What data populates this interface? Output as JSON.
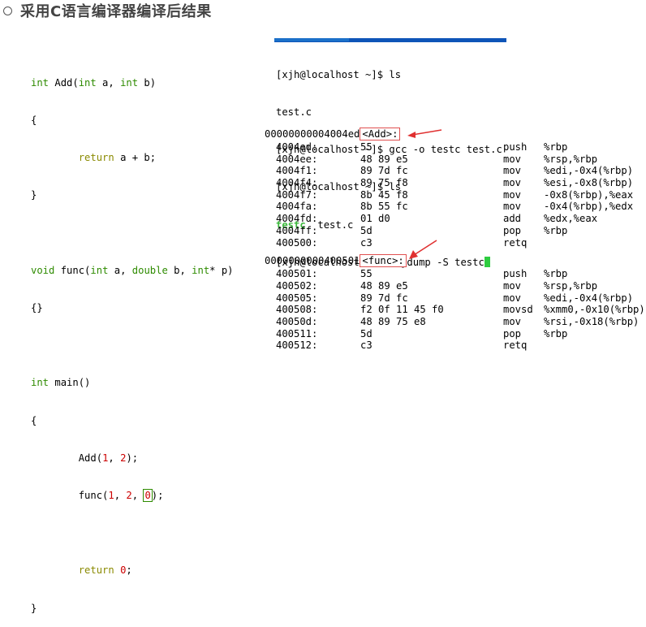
{
  "title": "采用C语言编译器编译后结果",
  "source_code": [
    "int Add(int a, int b)",
    "{",
    "        return a + b;",
    "}",
    "",
    "void func(int a, double b, int* p)",
    "{}",
    "",
    "int main()",
    "{",
    "        Add(1, 2);",
    "        func(1, 2, 0);",
    "",
    "        return 0;",
    "}"
  ],
  "terminal": {
    "lines": [
      "[xjh@localhost ~]$ ls",
      "test.c",
      "[xjh@localhost ~]$ gcc -o testc test.c",
      "[xjh@localhost ~]$ ls"
    ],
    "ls_result_exe": "testc",
    "ls_result_src": "  test.c",
    "last_prompt": "[xjh@localhost ~]$ objdump -S testc"
  },
  "disassembly": [
    {
      "address": "00000000004004ed",
      "symbol": "<Add>:",
      "rows": [
        {
          "addr": "4004ed:",
          "bytes": "55",
          "mnemonic": "push",
          "operands": "%rbp"
        },
        {
          "addr": "4004ee:",
          "bytes": "48 89 e5",
          "mnemonic": "mov",
          "operands": "%rsp,%rbp"
        },
        {
          "addr": "4004f1:",
          "bytes": "89 7d fc",
          "mnemonic": "mov",
          "operands": "%edi,-0x4(%rbp)"
        },
        {
          "addr": "4004f4:",
          "bytes": "89 75 f8",
          "mnemonic": "mov",
          "operands": "%esi,-0x8(%rbp)"
        },
        {
          "addr": "4004f7:",
          "bytes": "8b 45 f8",
          "mnemonic": "mov",
          "operands": "-0x8(%rbp),%eax"
        },
        {
          "addr": "4004fa:",
          "bytes": "8b 55 fc",
          "mnemonic": "mov",
          "operands": "-0x4(%rbp),%edx"
        },
        {
          "addr": "4004fd:",
          "bytes": "01 d0",
          "mnemonic": "add",
          "operands": "%edx,%eax"
        },
        {
          "addr": "4004ff:",
          "bytes": "5d",
          "mnemonic": "pop",
          "operands": "%rbp"
        },
        {
          "addr": "400500:",
          "bytes": "c3",
          "mnemonic": "retq",
          "operands": ""
        }
      ]
    },
    {
      "address": "0000000000400501",
      "symbol": "<func>:",
      "rows": [
        {
          "addr": "400501:",
          "bytes": "55",
          "mnemonic": "push",
          "operands": "%rbp"
        },
        {
          "addr": "400502:",
          "bytes": "48 89 e5",
          "mnemonic": "mov",
          "operands": "%rsp,%rbp"
        },
        {
          "addr": "400505:",
          "bytes": "89 7d fc",
          "mnemonic": "mov",
          "operands": "%edi,-0x4(%rbp)"
        },
        {
          "addr": "400508:",
          "bytes": "f2 0f 11 45 f0",
          "mnemonic": "movsd",
          "operands": "%xmm0,-0x10(%rbp)"
        },
        {
          "addr": "40050d:",
          "bytes": "48 89 75 e8",
          "mnemonic": "mov",
          "operands": "%rsi,-0x18(%rbp)"
        },
        {
          "addr": "400511:",
          "bytes": "5d",
          "mnemonic": "pop",
          "operands": "%rbp"
        },
        {
          "addr": "400512:",
          "bytes": "c3",
          "mnemonic": "retq",
          "operands": ""
        }
      ]
    }
  ],
  "colors": {
    "keyword_type": "#2e8b00",
    "keyword_return": "#8a8a00",
    "number": "#cc0000",
    "annotation_arrow": "#e03030",
    "terminal_bar": "#1b70c9"
  }
}
